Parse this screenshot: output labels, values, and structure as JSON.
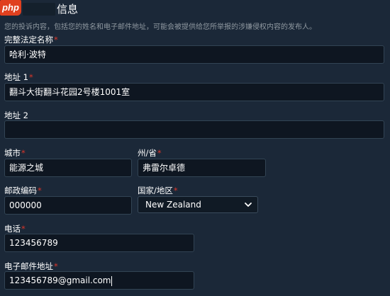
{
  "header": {
    "logo_text": "php",
    "title": "信息",
    "description": "您的投诉内容，包括您的姓名和电子邮件地址，可能会被提供给您所举报的涉嫌侵权内容的发布人。"
  },
  "required_marker": "*",
  "fields": {
    "legal_name": {
      "label": "完整法定名称",
      "value": "哈利·波特",
      "required": true
    },
    "address1": {
      "label": "地址 1",
      "value": "翻斗大街翻斗花园2号楼1001室",
      "required": true
    },
    "address2": {
      "label": "地址 2",
      "value": "",
      "required": false
    },
    "city": {
      "label": "城市",
      "value": "能源之城",
      "required": true
    },
    "state": {
      "label": "州/省",
      "value": "弗雷尔卓德",
      "required": true
    },
    "postal_code": {
      "label": "邮政编码",
      "value": "000000",
      "required": true
    },
    "country": {
      "label": "国家/地区",
      "selected": "New Zealand",
      "required": true
    },
    "phone": {
      "label": "电话",
      "value": "123456789",
      "required": true
    },
    "email": {
      "label": "电子邮件地址",
      "value": "123456789@gmail.com",
      "required": true
    }
  },
  "colors": {
    "background": "#1b2838",
    "input_background": "#0e1621",
    "required": "#d9362a",
    "logo": "#e0401f"
  },
  "icons": {
    "select_arrow": "chevron-down-icon"
  }
}
